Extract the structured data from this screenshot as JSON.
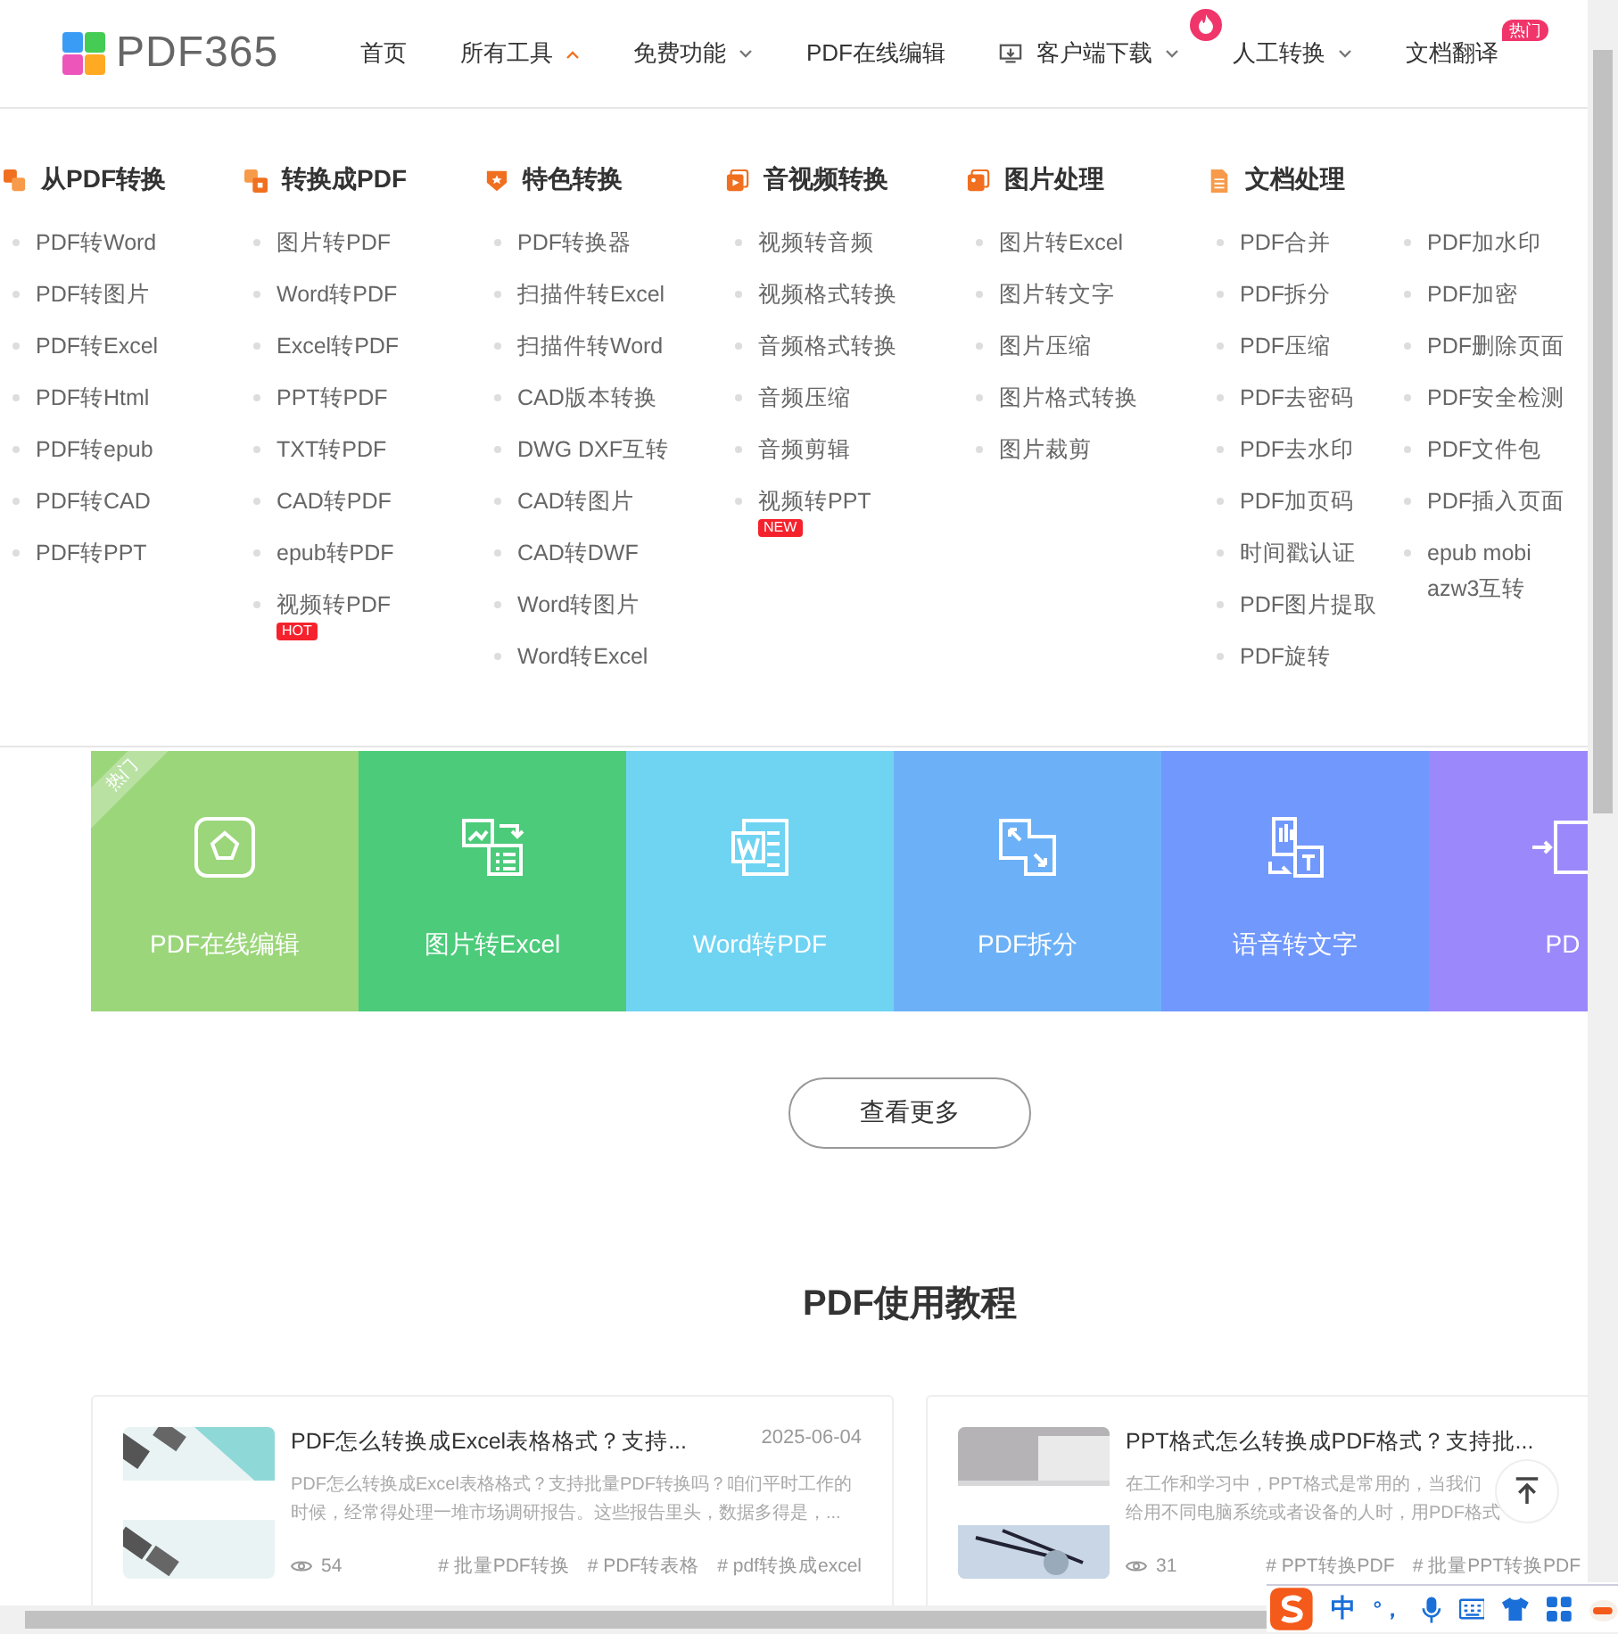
{
  "header": {
    "logo": "PDF365",
    "nav": [
      {
        "label": "首页",
        "kind": "link"
      },
      {
        "label": "所有工具",
        "kind": "menu",
        "expanded": true
      },
      {
        "label": "免费功能",
        "kind": "menu",
        "expanded": false
      },
      {
        "label": "PDF在线编辑",
        "kind": "link"
      },
      {
        "label": "客户端下载",
        "kind": "download",
        "expanded": false
      },
      {
        "label": "人工转换",
        "kind": "featured",
        "expanded": false
      },
      {
        "label": "文档翻译",
        "kind": "badged",
        "badge": "热门"
      }
    ]
  },
  "menu": [
    {
      "heading": "从PDF转换",
      "columns": [
        [
          {
            "label": "PDF转Word"
          },
          {
            "label": "PDF转图片"
          },
          {
            "label": "PDF转Excel"
          },
          {
            "label": "PDF转Html"
          },
          {
            "label": "PDF转epub"
          },
          {
            "label": "PDF转CAD"
          },
          {
            "label": "PDF转PPT"
          }
        ]
      ]
    },
    {
      "heading": "转换成PDF",
      "columns": [
        [
          {
            "label": "图片转PDF"
          },
          {
            "label": "Word转PDF"
          },
          {
            "label": "Excel转PDF"
          },
          {
            "label": "PPT转PDF"
          },
          {
            "label": "TXT转PDF"
          },
          {
            "label": "CAD转PDF"
          },
          {
            "label": "epub转PDF"
          },
          {
            "label": "视频转PDF",
            "badge": "HOT"
          }
        ]
      ]
    },
    {
      "heading": "特色转换",
      "columns": [
        [
          {
            "label": "PDF转换器"
          },
          {
            "label": "扫描件转Excel"
          },
          {
            "label": "扫描件转Word"
          },
          {
            "label": "CAD版本转换"
          },
          {
            "label": "DWG DXF互转"
          },
          {
            "label": "CAD转图片"
          },
          {
            "label": "CAD转DWF"
          },
          {
            "label": "Word转图片"
          },
          {
            "label": "Word转Excel"
          }
        ]
      ]
    },
    {
      "heading": "音视频转换",
      "columns": [
        [
          {
            "label": "视频转音频"
          },
          {
            "label": "视频格式转换"
          },
          {
            "label": "音频格式转换"
          },
          {
            "label": "音频压缩"
          },
          {
            "label": "音频剪辑"
          },
          {
            "label": "视频转PPT",
            "badge": "NEW"
          }
        ]
      ]
    },
    {
      "heading": "图片处理",
      "columns": [
        [
          {
            "label": "图片转Excel"
          },
          {
            "label": "图片转文字"
          },
          {
            "label": "图片压缩"
          },
          {
            "label": "图片格式转换"
          },
          {
            "label": "图片裁剪"
          }
        ]
      ]
    },
    {
      "heading": "文档处理",
      "columns": [
        [
          {
            "label": "PDF合并"
          },
          {
            "label": "PDF拆分"
          },
          {
            "label": "PDF压缩"
          },
          {
            "label": "PDF去密码"
          },
          {
            "label": "PDF去水印"
          },
          {
            "label": "PDF加页码"
          },
          {
            "label": "时间戳认证"
          },
          {
            "label": "PDF图片提取"
          },
          {
            "label": "PDF旋转"
          }
        ],
        [
          {
            "label": "PDF加水印"
          },
          {
            "label": "PDF加密"
          },
          {
            "label": "PDF删除页面"
          },
          {
            "label": "PDF安全检测"
          },
          {
            "label": "PDF文件包"
          },
          {
            "label": "PDF插入页面"
          },
          {
            "label": "epub mobi azw3互转"
          }
        ]
      ]
    }
  ],
  "tiles": [
    {
      "label": "PDF在线编辑",
      "color": "#9bd67a",
      "ribbon": "热门"
    },
    {
      "label": "图片转Excel",
      "color": "#4ccb7a"
    },
    {
      "label": "Word转PDF",
      "color": "#6fd3f2"
    },
    {
      "label": "PDF拆分",
      "color": "#6cb1f7"
    },
    {
      "label": "语音转文字",
      "color": "#7198fc"
    },
    {
      "label": "PD",
      "color": "#9b88fb"
    }
  ],
  "more_button": "查看更多",
  "tutorials": {
    "title": "PDF使用教程",
    "articles": [
      {
        "title": "PDF怎么转换成Excel表格格式？支持...",
        "date": "2025-06-04",
        "summary_lines": [
          "PDF怎么转换成Excel表格格式？支持批量PDF转换吗？咱们平时工作的",
          "时候，经常得处理一堆市场调研报告。这些报告里头，数据多得是，..."
        ],
        "views": "54",
        "tags": [
          "# 批量PDF转换",
          "# PDF转表格",
          "# pdf转换成excel"
        ]
      },
      {
        "title": "PPT格式怎么转换成PDF格式？支持批...",
        "summary_lines": [
          "在工作和学习中，PPT格式是常用的，当我们",
          "给用不同电脑系统或者设备的人时，用PDF格式"
        ],
        "views": "31",
        "tags": [
          "# PPT转换PDF",
          "# 批量PPT转换PDF"
        ]
      }
    ]
  },
  "ime_toolbar": {
    "mode": "中",
    "punct": "°，"
  }
}
